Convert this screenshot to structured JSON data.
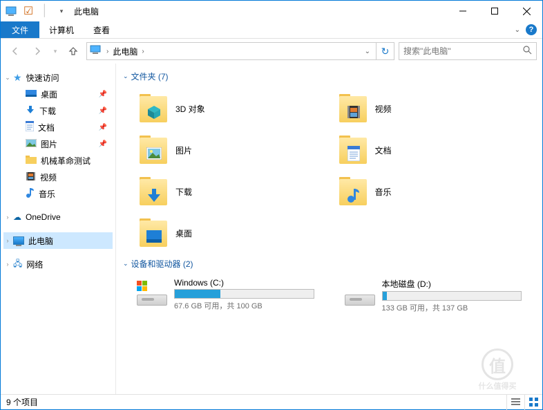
{
  "title": "此电脑",
  "ribbon": {
    "file": "文件",
    "computer": "计算机",
    "view": "查看"
  },
  "nav": {
    "back": "←",
    "forward": "→",
    "up": "↑"
  },
  "address": {
    "crumb": "此电脑"
  },
  "search": {
    "placeholder": "搜索\"此电脑\""
  },
  "sidebar": {
    "quick_access": "快速访问",
    "quick_items": [
      {
        "label": "桌面",
        "type": "desktop"
      },
      {
        "label": "下载",
        "type": "downloads"
      },
      {
        "label": "文档",
        "type": "documents"
      },
      {
        "label": "图片",
        "type": "pictures"
      },
      {
        "label": "机械革命测试",
        "type": "folder",
        "pinned": false
      },
      {
        "label": "视频",
        "type": "videos",
        "pinned": false
      },
      {
        "label": "音乐",
        "type": "music",
        "pinned": false
      }
    ],
    "onedrive": "OneDrive",
    "this_pc": "此电脑",
    "network": "网络"
  },
  "folders": {
    "header": "文件夹 (7)",
    "items": [
      {
        "label": "3D 对象",
        "overlay": "cube",
        "color": "#2fb8c5"
      },
      {
        "label": "视频",
        "overlay": "film",
        "color": "#3a3a3a"
      },
      {
        "label": "图片",
        "overlay": "photo",
        "color": "#4cb0e8"
      },
      {
        "label": "文档",
        "overlay": "doc",
        "color": "#3a7bd5"
      },
      {
        "label": "下载",
        "overlay": "down",
        "color": "#1e7fd6"
      },
      {
        "label": "音乐",
        "overlay": "note",
        "color": "#2f87e0"
      },
      {
        "label": "桌面",
        "overlay": "desk",
        "color": "#1e7fd6"
      }
    ]
  },
  "drives": {
    "header": "设备和驱动器 (2)",
    "items": [
      {
        "name": "Windows (C:)",
        "fill_pct": 33,
        "stats": "67.6 GB 可用，共 100 GB",
        "os": true
      },
      {
        "name": "本地磁盘 (D:)",
        "fill_pct": 3,
        "stats": "133 GB 可用，共 137 GB",
        "os": false
      }
    ]
  },
  "status": "9 个项目",
  "watermark": "什么值得买"
}
